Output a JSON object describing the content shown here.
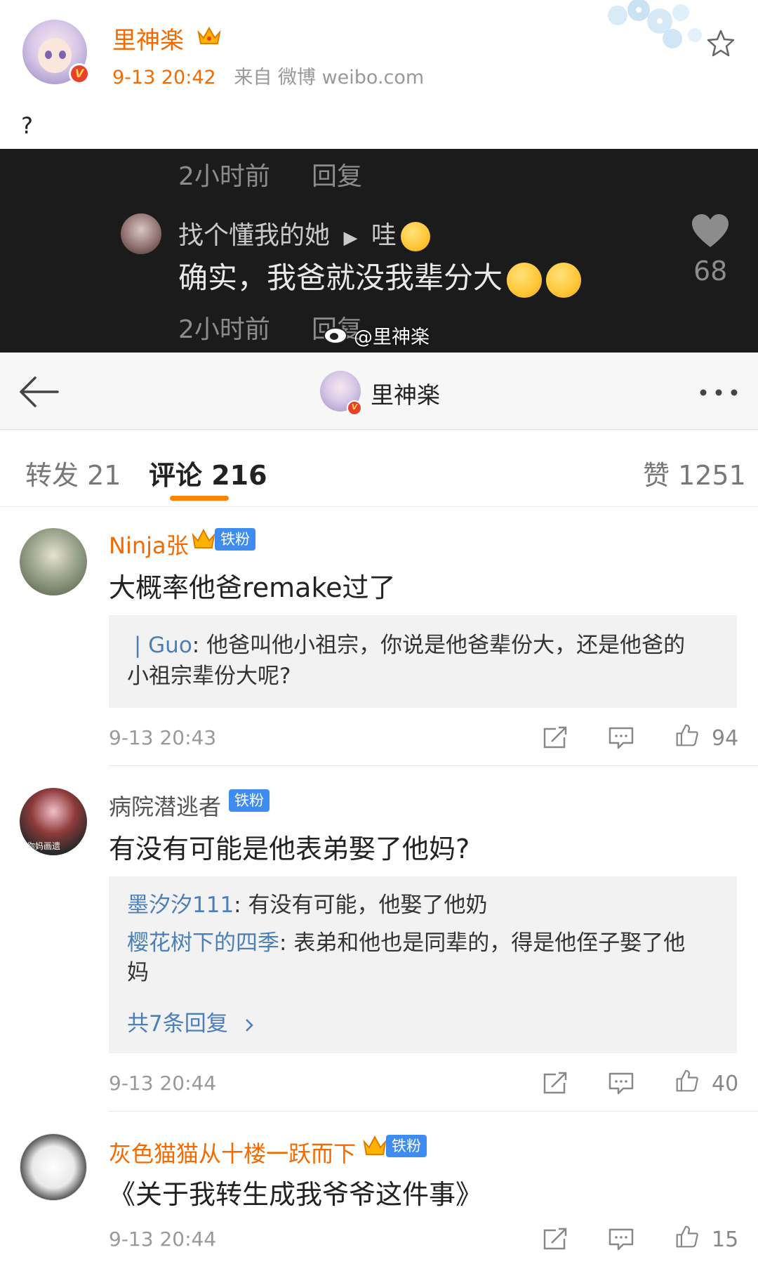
{
  "post": {
    "author": "里神楽",
    "time": "9-13 20:42",
    "source": "来自 微博 weibo.com",
    "text": "?"
  },
  "embedded_screenshot": {
    "prev_time": "2小时前",
    "prev_reply": "回复",
    "comment_user": "找个懂我的她",
    "comment_arrow": "▶",
    "comment_target": "哇",
    "comment_text": "确实，我爸就没我辈分大",
    "like_count": "68",
    "time": "2小时前",
    "reply": "回复",
    "watermark": "@里神楽"
  },
  "navbar": {
    "title": "里神楽"
  },
  "tabs": {
    "repost": "转发 21",
    "comments": "评论 216",
    "likes": "赞 1251"
  },
  "comments": [
    {
      "name": "Ninja张",
      "badge": "铁粉",
      "text": "大概率他爸remake过了",
      "replies": [
        {
          "name": "Guo",
          "text": "他爸叫他小祖宗，你说是他爸辈份大，还是他爸的",
          "cont": "小祖宗辈份大呢?"
        }
      ],
      "time": "9-13 20:43",
      "likes": "94"
    },
    {
      "name": "病院潜逃者",
      "badge": "铁粉",
      "text": "有没有可能是他表弟娶了他妈?",
      "replies": [
        {
          "name": "墨汐汐111",
          "text": "有没有可能，他娶了他奶"
        },
        {
          "name": "樱花树下的四季",
          "text": "表弟和他也是同辈的，得是他侄子娶了他",
          "cont": "妈"
        }
      ],
      "more": "共7条回复",
      "time": "9-13 20:44",
      "likes": "40"
    },
    {
      "name": "灰色猫猫从十楼一跃而下",
      "badge": "铁粉",
      "text": "《关于我转生成我爷爷这件事》",
      "time": "9-13 20:44",
      "likes": "15"
    }
  ],
  "avatar_text": "你妈画遗",
  "colors": {
    "accent": "#f56a00",
    "tab_underline": "#ff8200",
    "link": "#4a7fb8",
    "fan_badge": "#3f8cf0"
  }
}
